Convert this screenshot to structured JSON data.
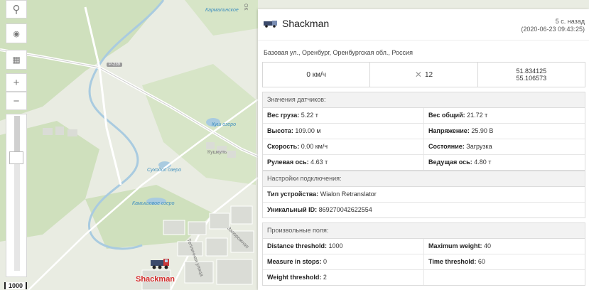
{
  "map": {
    "labels": {
      "karmalinskoe": "Кармалинское",
      "kush_lake": "Куш озеро",
      "kushkul": "Кушкуль",
      "sukhodol_lake": "Суходол озеро",
      "kamyshovoe_lake": "Камышовое озеро",
      "zaporozhnaya": "Запорожная",
      "teplichnaya": "Тепличная улица",
      "road_p239": "Р-239",
      "ok": "ОК"
    },
    "scale_label": "1000",
    "marker_label": "Shackman",
    "controls": {
      "search_icon": "⚲",
      "eye_icon": "◉",
      "layers_icon": "▦",
      "zoom_in": "+",
      "zoom_out": "−"
    },
    "zoom_level_fraction": 0.23
  },
  "panel": {
    "unit_name": "Shackman",
    "last_message_ago": "5 с. назад",
    "last_message_time": "(2020-06-23 09:43:25)",
    "address": "Базовая ул., Оренбург, Оренбургская обл., Россия",
    "speed": "0 км/ч",
    "satellites_icon": "✕",
    "satellites": "12",
    "lat": "51.834125",
    "lon": "55.106573",
    "sensors": {
      "title": "Значения датчиков:",
      "rows": [
        [
          {
            "k": "Вес груза:",
            "v": "5.22 т"
          },
          {
            "k": "Вес общий:",
            "v": "21.72 т"
          }
        ],
        [
          {
            "k": "Высота:",
            "v": "109.00 м"
          },
          {
            "k": "Напряжение:",
            "v": "25.90 В"
          }
        ],
        [
          {
            "k": "Скорость:",
            "v": "0.00 км/ч"
          },
          {
            "k": "Состояние:",
            "v": "Загрузка"
          }
        ],
        [
          {
            "k": "Рулевая ось:",
            "v": "4.63 т"
          },
          {
            "k": "Ведущая ось:",
            "v": "4.80 т"
          }
        ]
      ]
    },
    "connection": {
      "title": "Настройки подключения:",
      "device_type_key": "Тип устройства:",
      "device_type_val": "Wialon Retranslator",
      "uid_key": "Уникальный ID:",
      "uid_val": "869270042622554"
    },
    "custom": {
      "title": "Произвольные поля:",
      "rows": [
        [
          {
            "k": "Distance threshold:",
            "v": "1000"
          },
          {
            "k": "Maximum weight:",
            "v": "40"
          }
        ],
        [
          {
            "k": "Measure in stops:",
            "v": "0"
          },
          {
            "k": "Time threshold:",
            "v": "60"
          }
        ],
        [
          {
            "k": "Weight threshold:",
            "v": "2"
          },
          {
            "k": "",
            "v": ""
          }
        ]
      ]
    }
  },
  "colors": {
    "accent": "#d32a2a",
    "water_label": "#3f8fbf",
    "forest": "#c8dcb5",
    "river": "#a9cbe0"
  }
}
